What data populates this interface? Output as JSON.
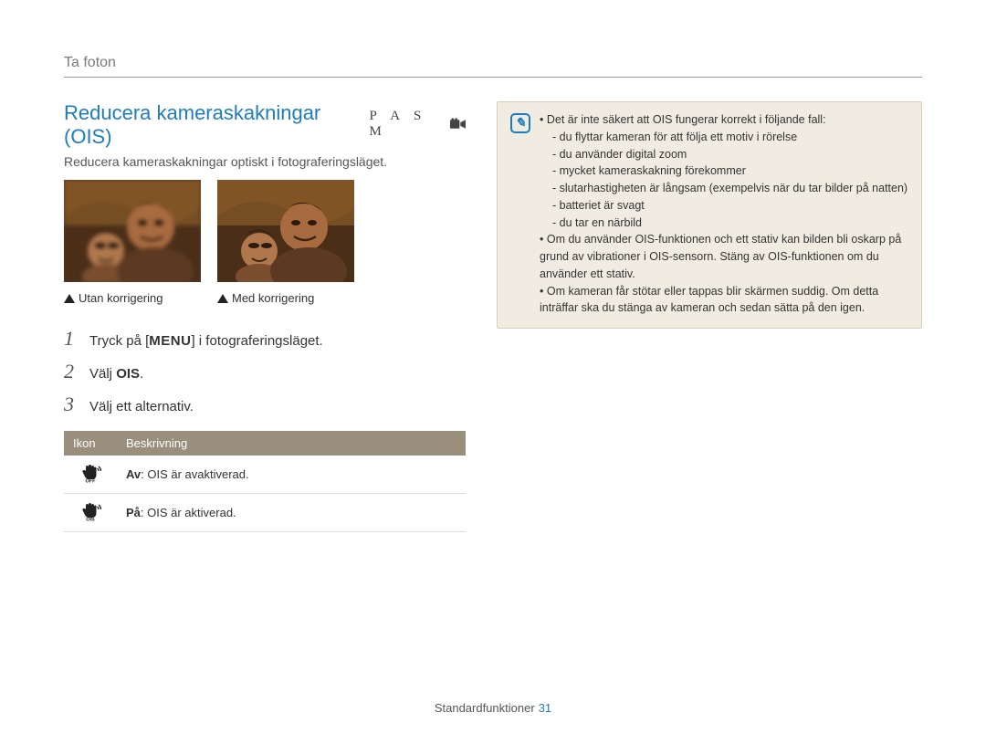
{
  "section_label": "Ta foton",
  "h2": "Reducera kameraskakningar (OIS)",
  "mode_letters": "P A S M",
  "subtitle": "Reducera kameraskakningar optiskt i fotograferingsläget.",
  "captions": {
    "before": "Utan korrigering",
    "after": "Med korrigering"
  },
  "steps": [
    {
      "pre": "Tryck på [",
      "menu": "MENU",
      "post": "] i fotograferingsläget."
    },
    {
      "pre": "Välj ",
      "bold": "OIS",
      "post": "."
    },
    {
      "pre": "Välj ett alternativ.",
      "bold": "",
      "post": ""
    }
  ],
  "table": {
    "headers": {
      "icon": "Ikon",
      "desc": "Beskrivning"
    },
    "rows": [
      {
        "icon_name": "ois-off-icon",
        "icon_sub": "OFF",
        "bold": "Av",
        "text": ": OIS är avaktiverad."
      },
      {
        "icon_name": "ois-on-icon",
        "icon_sub": "OIS",
        "bold": "På",
        "text": ": OIS är aktiverad."
      }
    ]
  },
  "note": {
    "bullets": [
      {
        "text": "Det är inte säkert att OIS fungerar korrekt i följande fall:",
        "sub": [
          "du flyttar kameran för att följa ett motiv i rörelse",
          "du använder digital zoom",
          "mycket kameraskakning förekommer",
          "slutarhastigheten är långsam (exempelvis när du tar bilder på natten)",
          "batteriet är svagt",
          "du tar en närbild"
        ]
      },
      {
        "text": "Om du använder OIS-funktionen och ett stativ kan bilden bli oskarp på grund av vibrationer i OIS-sensorn. Stäng av OIS-funktionen om du använder ett stativ."
      },
      {
        "text": "Om kameran får stötar eller tappas blir skärmen suddig. Om detta inträffar ska du stänga av kameran och sedan sätta på den igen."
      }
    ]
  },
  "footer": {
    "label": "Standardfunktioner",
    "page": "31"
  }
}
